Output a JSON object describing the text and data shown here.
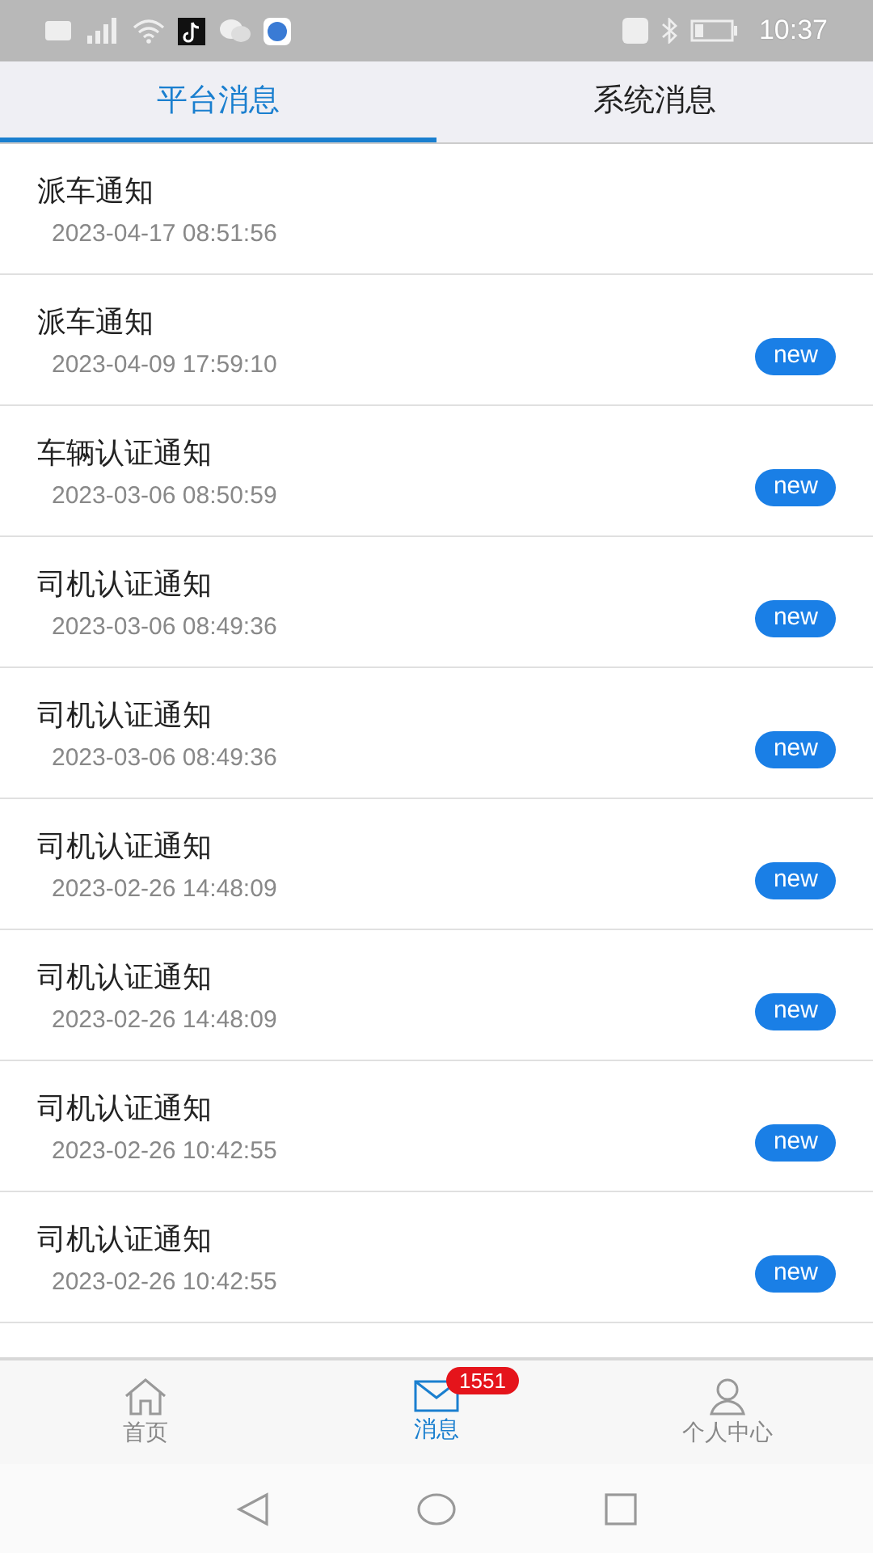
{
  "status_bar": {
    "time": "10:37"
  },
  "tabs": [
    {
      "label": "平台消息",
      "selected": true
    },
    {
      "label": "系统消息",
      "selected": false
    }
  ],
  "messages": [
    {
      "title": "派车通知",
      "time": "2023-04-17 08:51:56",
      "is_new": false
    },
    {
      "title": "派车通知",
      "time": "2023-04-09 17:59:10",
      "is_new": true,
      "badge": "new"
    },
    {
      "title": "车辆认证通知",
      "time": "2023-03-06 08:50:59",
      "is_new": true,
      "badge": "new"
    },
    {
      "title": "司机认证通知",
      "time": "2023-03-06 08:49:36",
      "is_new": true,
      "badge": "new"
    },
    {
      "title": "司机认证通知",
      "time": "2023-03-06 08:49:36",
      "is_new": true,
      "badge": "new"
    },
    {
      "title": "司机认证通知",
      "time": "2023-02-26 14:48:09",
      "is_new": true,
      "badge": "new"
    },
    {
      "title": "司机认证通知",
      "time": "2023-02-26 14:48:09",
      "is_new": true,
      "badge": "new"
    },
    {
      "title": "司机认证通知",
      "time": "2023-02-26 10:42:55",
      "is_new": true,
      "badge": "new"
    },
    {
      "title": "司机认证通知",
      "time": "2023-02-26 10:42:55",
      "is_new": true,
      "badge": "new"
    }
  ],
  "bottom_nav": [
    {
      "kind": "home",
      "label": "首页",
      "selected": false
    },
    {
      "kind": "mail",
      "label": "消息",
      "selected": true,
      "badge": "1551"
    },
    {
      "kind": "person",
      "label": "个人中心",
      "selected": false
    }
  ]
}
